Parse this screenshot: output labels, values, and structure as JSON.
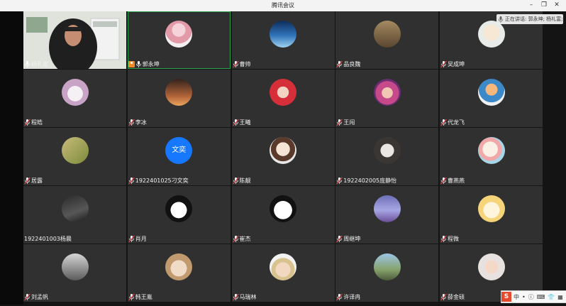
{
  "window": {
    "title": "腾讯会议"
  },
  "speaking": {
    "label": "正在讲话: 郭永坤; 杨礼富;"
  },
  "colors": {
    "active_border": "#2aa44c",
    "host_badge": "#f08a24",
    "text_avatar": "#1677ff"
  },
  "participants": [
    {
      "name": "杨礼富",
      "video": true,
      "mic": "on",
      "icon": "camera-video"
    },
    {
      "name": "郭永坤",
      "mic": "on",
      "host": true,
      "active": true,
      "icon": "avatar-girl-pink-dress"
    },
    {
      "name": "曹帅",
      "mic": "off",
      "icon": "avatar-space-aurora"
    },
    {
      "name": "品良魏",
      "mic": "off",
      "icon": "avatar-puppy-poster"
    },
    {
      "name": "吴成坤",
      "mic": "off",
      "icon": "avatar-cartoon-boy"
    },
    {
      "name": "程皓",
      "mic": "off",
      "icon": "avatar-cartoon-cow"
    },
    {
      "name": "李冰",
      "mic": "off",
      "icon": "avatar-sunset-person"
    },
    {
      "name": "王曦",
      "mic": "off",
      "icon": "avatar-anime-redhair"
    },
    {
      "name": "王闯",
      "mic": "off",
      "icon": "avatar-pink-hood-doll"
    },
    {
      "name": "代龙飞",
      "mic": "off",
      "icon": "avatar-toddler-doll"
    },
    {
      "name": "居露",
      "mic": "off",
      "icon": "avatar-leaf-green"
    },
    {
      "name": "1922401025刁文奕",
      "mic": "off",
      "avatar_text": "文奕",
      "icon": "avatar-text-blue"
    },
    {
      "name": "陈靓",
      "mic": "off",
      "icon": "avatar-anime-girl"
    },
    {
      "name": "1922402005庞静怡",
      "mic": "off",
      "icon": "avatar-cat-sleeping"
    },
    {
      "name": "曹燕燕",
      "mic": "off",
      "icon": "avatar-cartoon-doodle"
    },
    {
      "name": "1922401003杨晨",
      "mic": "none",
      "icon": "avatar-laptop-dark"
    },
    {
      "name": "肖月",
      "mic": "off",
      "icon": "avatar-black-cartoon"
    },
    {
      "name": "崔杰",
      "mic": "off",
      "icon": "avatar-panda-face"
    },
    {
      "name": "周继坤",
      "mic": "off",
      "icon": "avatar-purple-landscape"
    },
    {
      "name": "程微",
      "mic": "off",
      "icon": "avatar-sheep-cartoon"
    },
    {
      "name": "刘孟帆",
      "mic": "off",
      "icon": "avatar-gray-portrait"
    },
    {
      "name": "韩王胤",
      "mic": "off",
      "icon": "avatar-cat-sunglasses"
    },
    {
      "name": "马瑞林",
      "mic": "off",
      "icon": "avatar-blond-boy"
    },
    {
      "name": "许译冉",
      "mic": "off",
      "icon": "avatar-outdoor-figure"
    },
    {
      "name": "薛金硕",
      "mic": "off",
      "icon": "avatar-baby-photo"
    }
  ],
  "ime": {
    "brand": "S",
    "items": [
      "中",
      "•",
      "ⓘ",
      "⌨",
      "👕",
      "▦"
    ]
  }
}
